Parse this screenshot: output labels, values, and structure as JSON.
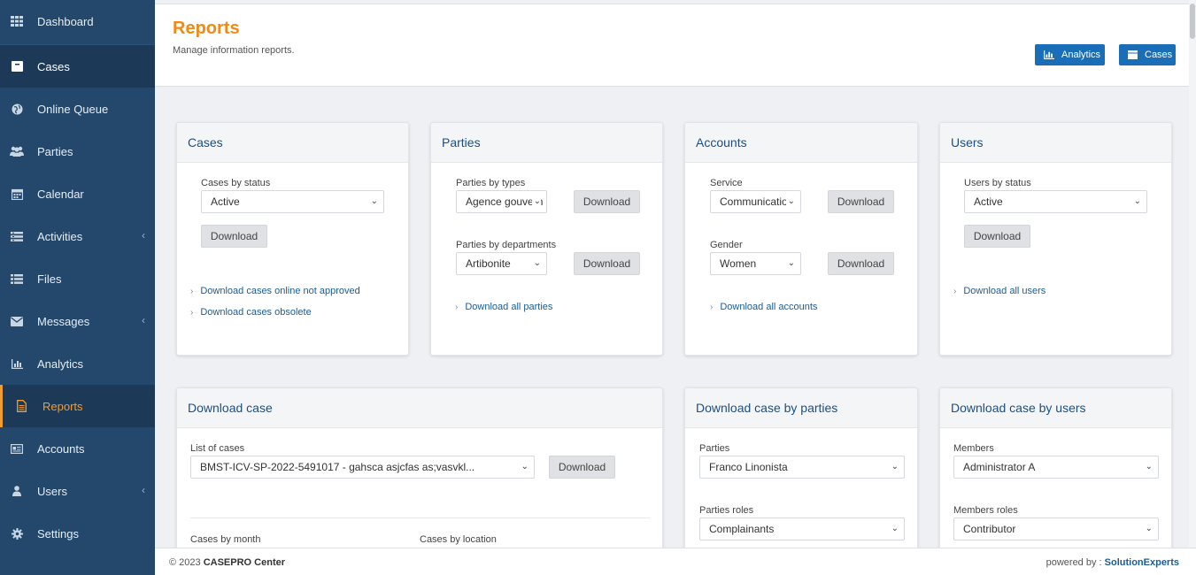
{
  "sidebar": {
    "items": [
      {
        "label": "Dashboard",
        "icon": "grid-icon"
      },
      {
        "label": "Cases",
        "icon": "archive-icon"
      },
      {
        "label": "Online Queue",
        "icon": "globe-icon"
      },
      {
        "label": "Parties",
        "icon": "users-icon"
      },
      {
        "label": "Calendar",
        "icon": "calendar-icon"
      },
      {
        "label": "Activities",
        "icon": "list-icon"
      },
      {
        "label": "Files",
        "icon": "list-bullets-icon"
      },
      {
        "label": "Messages",
        "icon": "envelope-icon"
      },
      {
        "label": "Analytics",
        "icon": "bar-chart-icon"
      },
      {
        "label": "Reports",
        "icon": "document-icon"
      },
      {
        "label": "Accounts",
        "icon": "id-card-icon"
      },
      {
        "label": "Users",
        "icon": "user-icon"
      },
      {
        "label": "Settings",
        "icon": "gear-icon"
      }
    ]
  },
  "header": {
    "title": "Reports",
    "subtitle": "Manage information reports.",
    "analytics_label": "Analytics",
    "cases_label": "Cases"
  },
  "cards": {
    "cases": {
      "title": "Cases",
      "status_label": "Cases by status",
      "status_value": "Active",
      "download": "Download",
      "link1": "Download cases online not approved",
      "link2": "Download cases obsolete"
    },
    "parties": {
      "title": "Parties",
      "types_label": "Parties by types",
      "types_value": "Agence gouvern",
      "departments_label": "Parties by departments",
      "departments_value": "Artibonite",
      "download": "Download",
      "link": "Download all parties"
    },
    "accounts": {
      "title": "Accounts",
      "service_label": "Service",
      "service_value": "Communication",
      "gender_label": "Gender",
      "gender_value": "Women",
      "download": "Download",
      "link": "Download all accounts"
    },
    "users": {
      "title": "Users",
      "status_label": "Users by status",
      "status_value": "Active",
      "download": "Download",
      "link": "Download all users"
    },
    "download_case": {
      "title": "Download case",
      "list_label": "List of cases",
      "list_value": "BMST-ICV-SP-2022-5491017 - gahsca asjcfas as;vasvkl...",
      "download": "Download",
      "month_label": "Cases by month",
      "location_label": "Cases by location"
    },
    "by_parties": {
      "title": "Download case by parties",
      "parties_label": "Parties",
      "parties_value": "Franco Linonista",
      "roles_label": "Parties roles",
      "roles_value": "Complainants"
    },
    "by_users": {
      "title": "Download case by users",
      "members_label": "Members",
      "members_value": "Administrator A",
      "roles_label": "Members roles",
      "roles_value": "Contributor"
    }
  },
  "footer": {
    "copyright": "© 2023",
    "brand": "CASEPRO Center",
    "powered": "powered by :",
    "company": "SolutionExperts"
  },
  "colors": {
    "sidebar_bg": "#24486b",
    "accent": "#f28a13",
    "primary": "#1a6eb7",
    "link": "#1b5c96"
  }
}
